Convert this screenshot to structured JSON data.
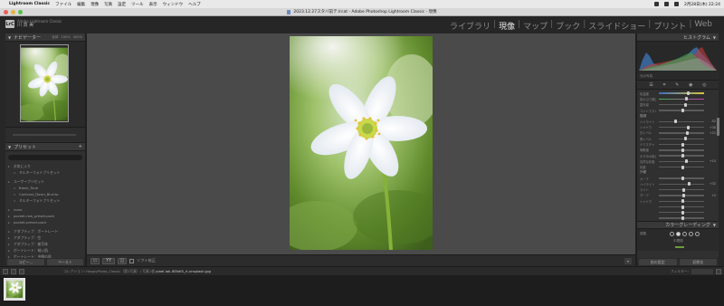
{
  "menubar": {
    "app_name": "Lightroom Classic",
    "items": [
      "ファイル",
      "編集",
      "現像",
      "写真",
      "設定",
      "ツール",
      "表示",
      "ウィンドウ",
      "ヘルプ"
    ],
    "clock": "2月28日(木) 22:24"
  },
  "window": {
    "title": "2023.12.27スタバ前テ.lrcat - Adobe Photoshop Lightroom Classic - 現像"
  },
  "identity": {
    "badge": "LrC",
    "line1": "Adobe Lightroom Classic",
    "line2": "川 真 美"
  },
  "modules": {
    "items": [
      "ライブラリ",
      "現像",
      "マップ",
      "ブック",
      "スライドショー",
      "プリント",
      "Web"
    ],
    "active": "現像",
    "separator": "|"
  },
  "left": {
    "navigator_title": "ナビゲーター",
    "zooms": [
      "全体",
      "100%",
      "400%"
    ],
    "presets_title": "プリセット",
    "presets": [
      {
        "type": "group",
        "label": "お気に入り"
      },
      {
        "type": "child",
        "label": "ミルキーフォトプリセット"
      },
      {
        "type": "group",
        "label": "ユーザープリセット",
        "gap": true
      },
      {
        "type": "child",
        "label": "Blank_Tone"
      },
      {
        "type": "child",
        "label": "Contrast_Down_BlurUp"
      },
      {
        "type": "child",
        "label": "ミルキーフォトプリセット"
      },
      {
        "type": "group",
        "label": "nono",
        "gap": true
      },
      {
        "type": "group",
        "label": "pocket-raw_preset.pack"
      },
      {
        "type": "group",
        "label": "pocket-preset.pack"
      },
      {
        "type": "group",
        "label": "アダプティブ：ポートレート",
        "gap": true
      },
      {
        "type": "group",
        "label": "アダプティブ：空"
      },
      {
        "type": "group",
        "label": "アダプティブ：被写体"
      },
      {
        "type": "group",
        "label": "ポートレート：暗い肌"
      },
      {
        "type": "group",
        "label": "ポートレート：中間の肌"
      },
      {
        "type": "group",
        "label": "ポートレート：明るい肌"
      }
    ],
    "copy_button": "コピー...",
    "paste_button": "ペースト"
  },
  "toolbar": {
    "view_single": "▭",
    "view_compare": "YY",
    "soft_proof_label": "ソフト校正"
  },
  "right": {
    "histogram_title": "ヒストグラム",
    "histogram_info": "元の写真",
    "basic_groups": [
      "階調",
      "外観"
    ],
    "sliders": [
      {
        "label": "色温度",
        "value": "",
        "pos": 0.62
      },
      {
        "label": "色かぶり補正",
        "value": "",
        "pos": 0.58
      },
      {
        "label": "露光量",
        "value": "",
        "pos": 0.55
      },
      {
        "label": "コントラスト",
        "value": "",
        "pos": 0.5
      },
      {
        "label": "",
        "value": "",
        "pos": 0.5
      },
      {
        "label": "ハイライト",
        "value": "-52",
        "pos": 0.34
      },
      {
        "label": "シャドウ",
        "value": "+30",
        "pos": 0.62
      },
      {
        "label": "白レベル",
        "value": "+21",
        "pos": 0.6
      },
      {
        "label": "黒レベル",
        "value": "",
        "pos": 0.55
      },
      {
        "label": "テクスチャ",
        "value": "",
        "pos": 0.5
      },
      {
        "label": "明瞭度",
        "value": "",
        "pos": 0.5
      },
      {
        "label": "かすみの除去",
        "value": "",
        "pos": 0.5
      },
      {
        "label": "自然な彩度",
        "value": "+15",
        "pos": 0.58
      },
      {
        "label": "彩度",
        "value": "",
        "pos": 0.5
      },
      {
        "label": "",
        "value": "",
        "pos": 0.5
      },
      {
        "label": "カーブ",
        "value": "",
        "pos": 0.5
      },
      {
        "label": "ハイライト",
        "value": "+32",
        "pos": 0.64
      },
      {
        "label": "ライト",
        "value": "",
        "pos": 0.52
      },
      {
        "label": "ダーク",
        "value": "+2",
        "pos": 0.51
      },
      {
        "label": "シャドウ",
        "value": "",
        "pos": 0.5
      },
      {
        "label": "",
        "value": "",
        "pos": 0.5
      },
      {
        "label": "",
        "value": "",
        "pos": 0.5
      },
      {
        "label": "",
        "value": "",
        "pos": 0.5
      }
    ],
    "color_grading_title": "カラーグレーディング",
    "cg_label": "調整",
    "cg_sub": "中間調",
    "prev_button": "前の設定",
    "reset_button": "初期化"
  },
  "filmstrip": {
    "path_prefix": "コレクション: HappyPhoto_Classic（第2写真）/ 写真1枚",
    "file": "pixel-iok-IE0tdI5_rl-unsplash.jpg",
    "filter_label": "フィルター:"
  }
}
